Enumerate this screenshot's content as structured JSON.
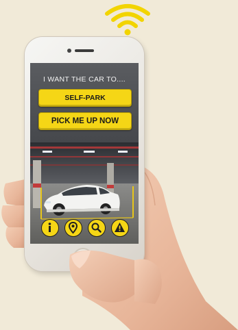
{
  "screen": {
    "prompt": "I WANT THE CAR TO....",
    "buttons": {
      "self_park": "SELF-PARK",
      "pick_me_up": "PICK ME UP NOW"
    },
    "icons": [
      "info-icon",
      "location-pin-icon",
      "search-icon",
      "warning-icon"
    ]
  },
  "colors": {
    "background": "#f1ead8",
    "accent_yellow": "#f5d616",
    "screen_dark": "#4a4c50"
  }
}
